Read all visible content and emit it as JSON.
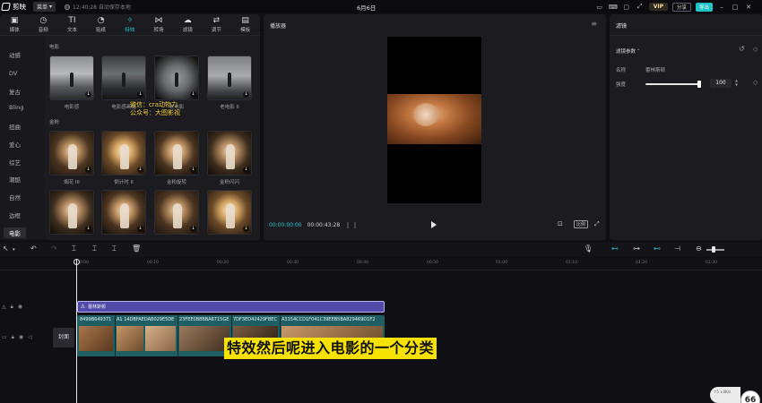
{
  "app": {
    "name": "剪映",
    "menu_label": "菜单",
    "save_status": "12:40:28 自动保存本地",
    "doc_title": "6月6日",
    "vip_label": "VIP",
    "share_label": "分享",
    "export_label": "导出"
  },
  "tool_tabs": [
    {
      "label": "媒体",
      "icon": "▣"
    },
    {
      "label": "音频",
      "icon": "◷"
    },
    {
      "label": "文本",
      "icon": "TI"
    },
    {
      "label": "贴纸",
      "icon": "◔"
    },
    {
      "label": "特效",
      "icon": "✧"
    },
    {
      "label": "转场",
      "icon": "⋈"
    },
    {
      "label": "滤镜",
      "icon": "☁"
    },
    {
      "label": "调节",
      "icon": "⇄"
    },
    {
      "label": "模板",
      "icon": "▤"
    }
  ],
  "categories": [
    "动感",
    "DV",
    "复古",
    "Bling",
    "扭曲",
    "爱心",
    "综艺",
    "潮酷",
    "自然",
    "边框",
    "电影"
  ],
  "effects": {
    "section_movie": "电影",
    "section_gold": "金粉",
    "movie_items": [
      "电影感",
      "电影感画幅",
      "老电影",
      "老电影 II"
    ],
    "gold_items": [
      "烟花 III",
      "倒计时 II",
      "金粉旋转",
      "金粉闪闪"
    ],
    "watermark_line1": "微信：cra动物力",
    "watermark_line2": "公众号：大图影视"
  },
  "player": {
    "title": "播放器",
    "current_time": "00:00:00:00",
    "total_time": "00:00:43:28",
    "ratio_label": "比例"
  },
  "properties": {
    "tab_label": "滤镜",
    "section_label": "滤镜参数",
    "name_label": "名称",
    "name_value": "蕾林斯顿",
    "strength_label": "强度",
    "strength_value": "100"
  },
  "ruler_labels": [
    "00:00",
    "00:10",
    "00:20",
    "00:30",
    "00:40",
    "00:50",
    "01:00",
    "01:10",
    "01:20",
    "01:30"
  ],
  "timeline": {
    "effect_clip_label": "蕾林斯顿",
    "cover_label": "封面",
    "clip_names": [
      "8499B649371",
      "A1 14DBFAEDAB029E5DE",
      "23FEE0B8BBA6715GE",
      "7DF3ED42429FBEC",
      "A3154CCD1F041C39EEB5BA829469D1F2"
    ],
    "subtitle": "特效然后呢进入电影的一个分类"
  },
  "overlay": {
    "chip_text": "↑5 ↓0K/s",
    "badge_value": "66"
  },
  "colors": {
    "accent": "#23c6cf",
    "effect_clip": "#524aa8",
    "video_track": "#1f5f63",
    "subtitle_bg": "#f6e100"
  }
}
